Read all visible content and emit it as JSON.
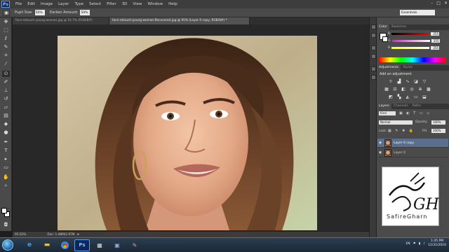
{
  "menubar": {
    "logo": "Ps",
    "items": [
      "File",
      "Edit",
      "Image",
      "Layer",
      "Type",
      "Select",
      "Filter",
      "3D",
      "View",
      "Window",
      "Help"
    ],
    "window_controls": [
      "–",
      "□",
      "✕"
    ]
  },
  "options": {
    "pupil_size_label": "Pupil Size:",
    "pupil_size_value": "50%",
    "darken_amount_label": "Darken Amount:",
    "darken_amount_value": "50%",
    "workspace": "Essentials"
  },
  "tabs": [
    {
      "label": "face-retouch-young-woman.jpg @ 16.7% (RGB/8#)",
      "active": false
    },
    {
      "label": "face-retouch-young-woman-Recovered.jpg @ 95% (Layer 0 copy, RGB/8#) *",
      "active": true
    }
  ],
  "status": {
    "zoom": "95.02%",
    "doc": "Doc: 1.48M/2.97M"
  },
  "color_panel": {
    "tabs": [
      "Color",
      "Swatches"
    ],
    "r": "255",
    "g": "255",
    "b": "255"
  },
  "adjustments_panel": {
    "tabs": [
      "Adjustments",
      "Styles"
    ],
    "heading": "Add an adjustment"
  },
  "layers_panel": {
    "tabs": [
      "Layers",
      "Channels",
      "Paths"
    ],
    "kind": "Kind",
    "blend_mode": "Normal",
    "opacity_label": "Opacity:",
    "opacity_value": "100%",
    "lock_label": "Lock:",
    "fill_label": "Fill:",
    "fill_value": "100%",
    "layers": [
      {
        "name": "Layer 0 copy",
        "selected": true
      },
      {
        "name": "Layer 0",
        "selected": false
      }
    ]
  },
  "watermark": {
    "text": "SafireGharn"
  },
  "taskbar": {
    "apps": [
      "ie",
      "folder",
      "chrome",
      "photoshop",
      "media",
      "photos",
      "paint"
    ],
    "lang": "EN",
    "time": "1:45 PM",
    "date": "12/31/2016"
  },
  "colors": {
    "ps_blue": "#10255a",
    "layer_selected": "#5a6e8e"
  }
}
